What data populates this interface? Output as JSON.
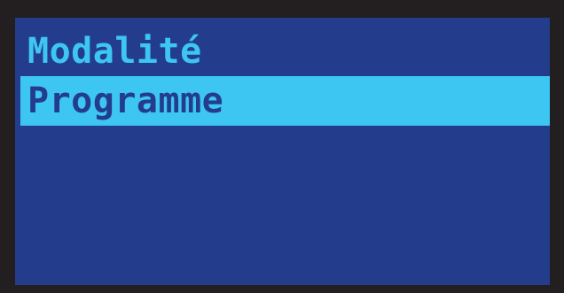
{
  "menu": {
    "items": [
      {
        "label": "Modalité",
        "selected": false
      },
      {
        "label": "Programme",
        "selected": true
      }
    ]
  },
  "colors": {
    "screen_background": "#233d8c",
    "highlight": "#3ec6f3",
    "bezel": "#231f20"
  }
}
